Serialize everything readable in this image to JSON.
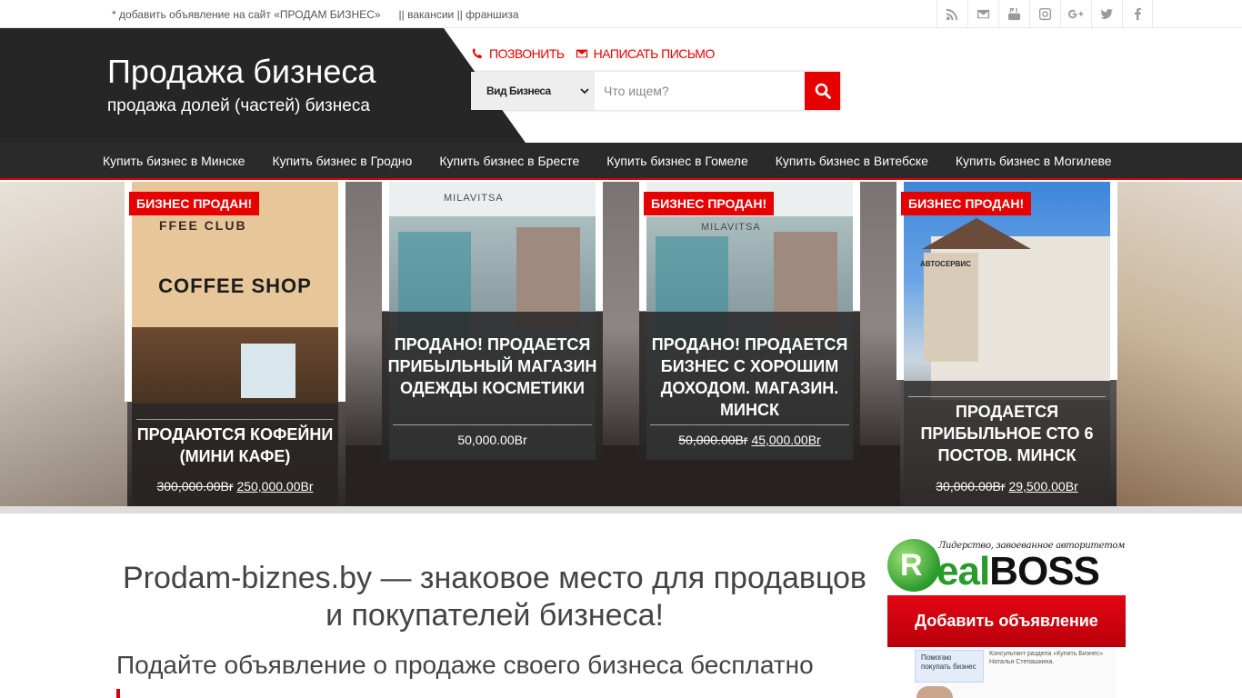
{
  "topbar": {
    "links": [
      "* добавить объявление на сайт «ПРОДАМ БИЗНЕС»",
      "|| вакансии || франшиза"
    ],
    "social": [
      "rss-icon",
      "mail-icon",
      "youtube-icon",
      "instagram-icon",
      "google-plus-icon",
      "twitter-icon",
      "facebook-icon"
    ]
  },
  "header": {
    "title": "Продажа бизнеса",
    "subtitle": "продажа долей (частей) бизнеса",
    "call": "ПОЗВОНИТЬ",
    "write": "НАПИСАТЬ ПИСЬМО",
    "search": {
      "select": "Вид Бизнеса",
      "placeholder": "Что ищем?"
    }
  },
  "nav": [
    "Купить бизнес в Минске",
    "Купить бизнес в Гродно",
    "Купить бизнес в Бресте",
    "Купить бизнес в Гомеле",
    "Купить бизнес в Витебске",
    "Купить бизнес в Могилеве"
  ],
  "slides": [
    {
      "badge": "БИЗНЕС ПРОДАН!",
      "title": "ПРОДАЮТСЯ КОФЕЙНИ (МИНИ КАФЕ)",
      "price_old": "300,000.00Br",
      "price_new": "250,000.00Br",
      "photo_text": "COFFEE SHOP",
      "photo_top": "FFEE CLUB"
    },
    {
      "badge": "",
      "title": "ПРОДАНО! ПРОДАЕТСЯ ПРИБЫЛЬНЫЙ МАГАЗИН ОДЕЖДЫ КОСМЕТИКИ",
      "price": "50,000.00Br",
      "photo_text": "MILAVITSA"
    },
    {
      "badge": "БИЗНЕС ПРОДАН!",
      "title": "ПРОДАНО! ПРОДАЕТСЯ БИЗНЕС С ХОРОШИМ ДОХОДОМ. МАГАЗИН. МИНСК",
      "price_old": "50,000.00Br",
      "price_new": "45,000.00Br",
      "photo_text": "MILAVITSA"
    },
    {
      "badge": "БИЗНЕС ПРОДАН!",
      "title": "ПРОДАЕТСЯ ПРИБЫЛЬНОЕ СТО 6 ПОСТОВ. МИНСК",
      "price_old": "30,000.00Br",
      "price_new": "29,500.00Br",
      "photo_text": "АВТОСЕРВИС"
    }
  ],
  "main": {
    "welcome": "Prodam-biznes.by — знаковое место для продавцов и покупателей бизнеса!",
    "sub": "Подайте объявление о продаже своего бизнеса бесплатно"
  },
  "ad": {
    "slogan": "Лидерство, завоеванное авторитетом",
    "brand_r": "R",
    "brand_eal": "eal",
    "brand_boss": "BOSS",
    "button": "Добавить объявление",
    "box": "Помогаю покупать бизнес",
    "text": "Консультант раздела «Купить Бизнес» Наталья Степашкина."
  }
}
